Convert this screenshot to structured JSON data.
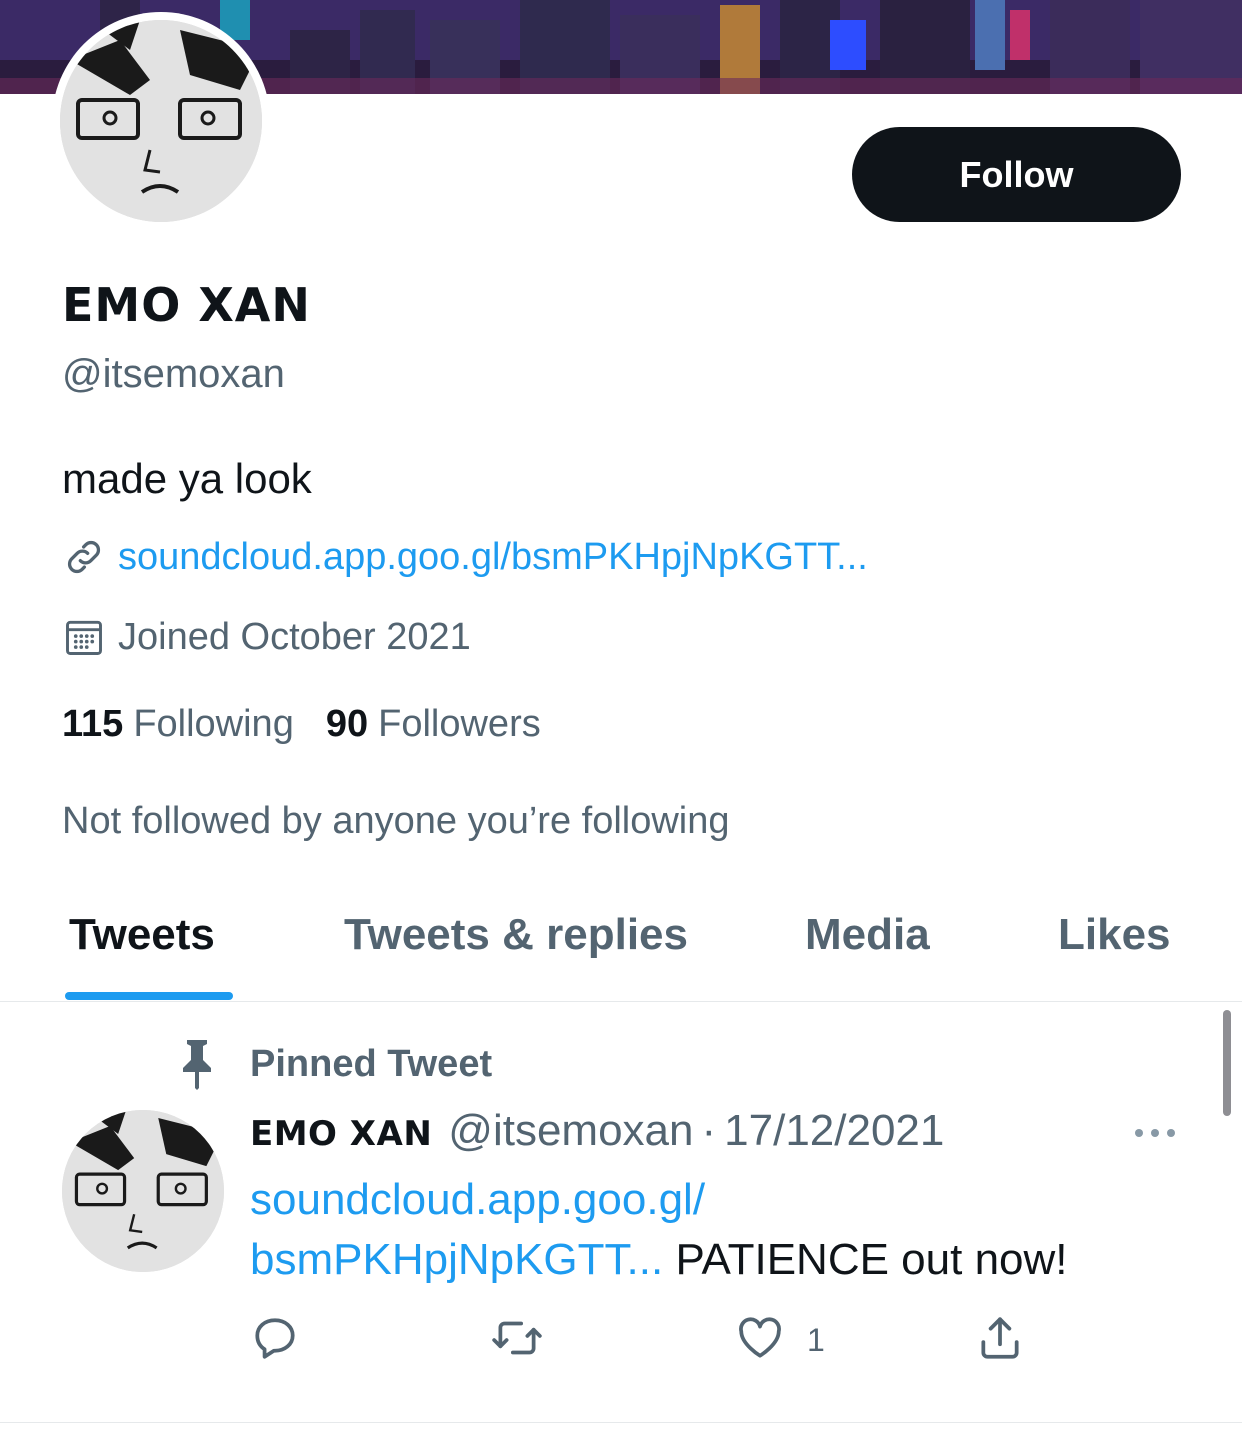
{
  "profile": {
    "display_name": "EMO XAN",
    "handle": "@itsemoxan",
    "bio": "made ya look",
    "link_text": "soundcloud.app.goo.gl/bsmPKHpjNpKGTT...",
    "joined": "Joined October 2021",
    "follow_label": "Follow",
    "following_count": "115",
    "following_label": "Following",
    "followers_count": "90",
    "followers_label": "Followers",
    "not_followed_text": "Not followed by anyone you’re following"
  },
  "tabs": [
    {
      "label": "Tweets",
      "active": true
    },
    {
      "label": "Tweets & replies",
      "active": false
    },
    {
      "label": "Media",
      "active": false
    },
    {
      "label": "Likes",
      "active": false
    }
  ],
  "pinned_tweet": {
    "pinned_label": "Pinned Tweet",
    "author_name": "EMO XAN",
    "author_handle": "@itsemoxan",
    "separator": "·",
    "date": "17/12/2021",
    "link_line1": "soundcloud.app.goo.gl/",
    "link_line2": "bsmPKHpjNpKGTT...",
    "text_rest": " PATIENCE out now!",
    "like_count": "1"
  },
  "icons": {
    "link": "link-icon",
    "calendar": "calendar-icon",
    "pin": "pin-icon",
    "more": "more-icon",
    "reply": "reply-icon",
    "retweet": "retweet-icon",
    "like": "heart-icon",
    "share": "share-icon"
  },
  "colors": {
    "accent": "#1d9bf0",
    "primary_text": "#0f1419",
    "secondary_text": "#536471",
    "follow_button_bg": "#0f1419"
  }
}
